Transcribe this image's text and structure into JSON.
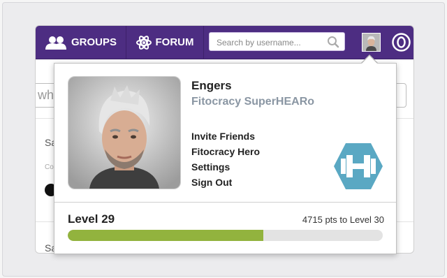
{
  "nav": {
    "groups_label": "GROUPS",
    "forum_label": "FORUM",
    "search_placeholder": "Search by username..."
  },
  "background": {
    "input_partial_text": "wh",
    "row1_text": "Sa",
    "row1_small": "Co",
    "row2_text": "Sa"
  },
  "profile": {
    "username": "Engers",
    "title": "Fitocracy SuperHEARo"
  },
  "menu": [
    {
      "label": "Invite Friends"
    },
    {
      "label": "Fitocracy Hero"
    },
    {
      "label": "Settings"
    },
    {
      "label": "Sign Out"
    }
  ],
  "level": {
    "label": "Level 29",
    "points_text": "4715 pts to Level 30",
    "progress_fraction": 0.62
  },
  "colors": {
    "nav_bg": "#4d2d82",
    "progress_fill": "#92b33e",
    "progress_track": "#e3e3e3",
    "hero_badge": "#5aa8c3",
    "title_gray": "#8a96a3"
  },
  "icons": {
    "groups": "groups-icon",
    "forum": "atom-icon",
    "search": "search-icon",
    "brand": "fitocracy-logo",
    "hero": "dumbbell-hexagon-icon"
  }
}
